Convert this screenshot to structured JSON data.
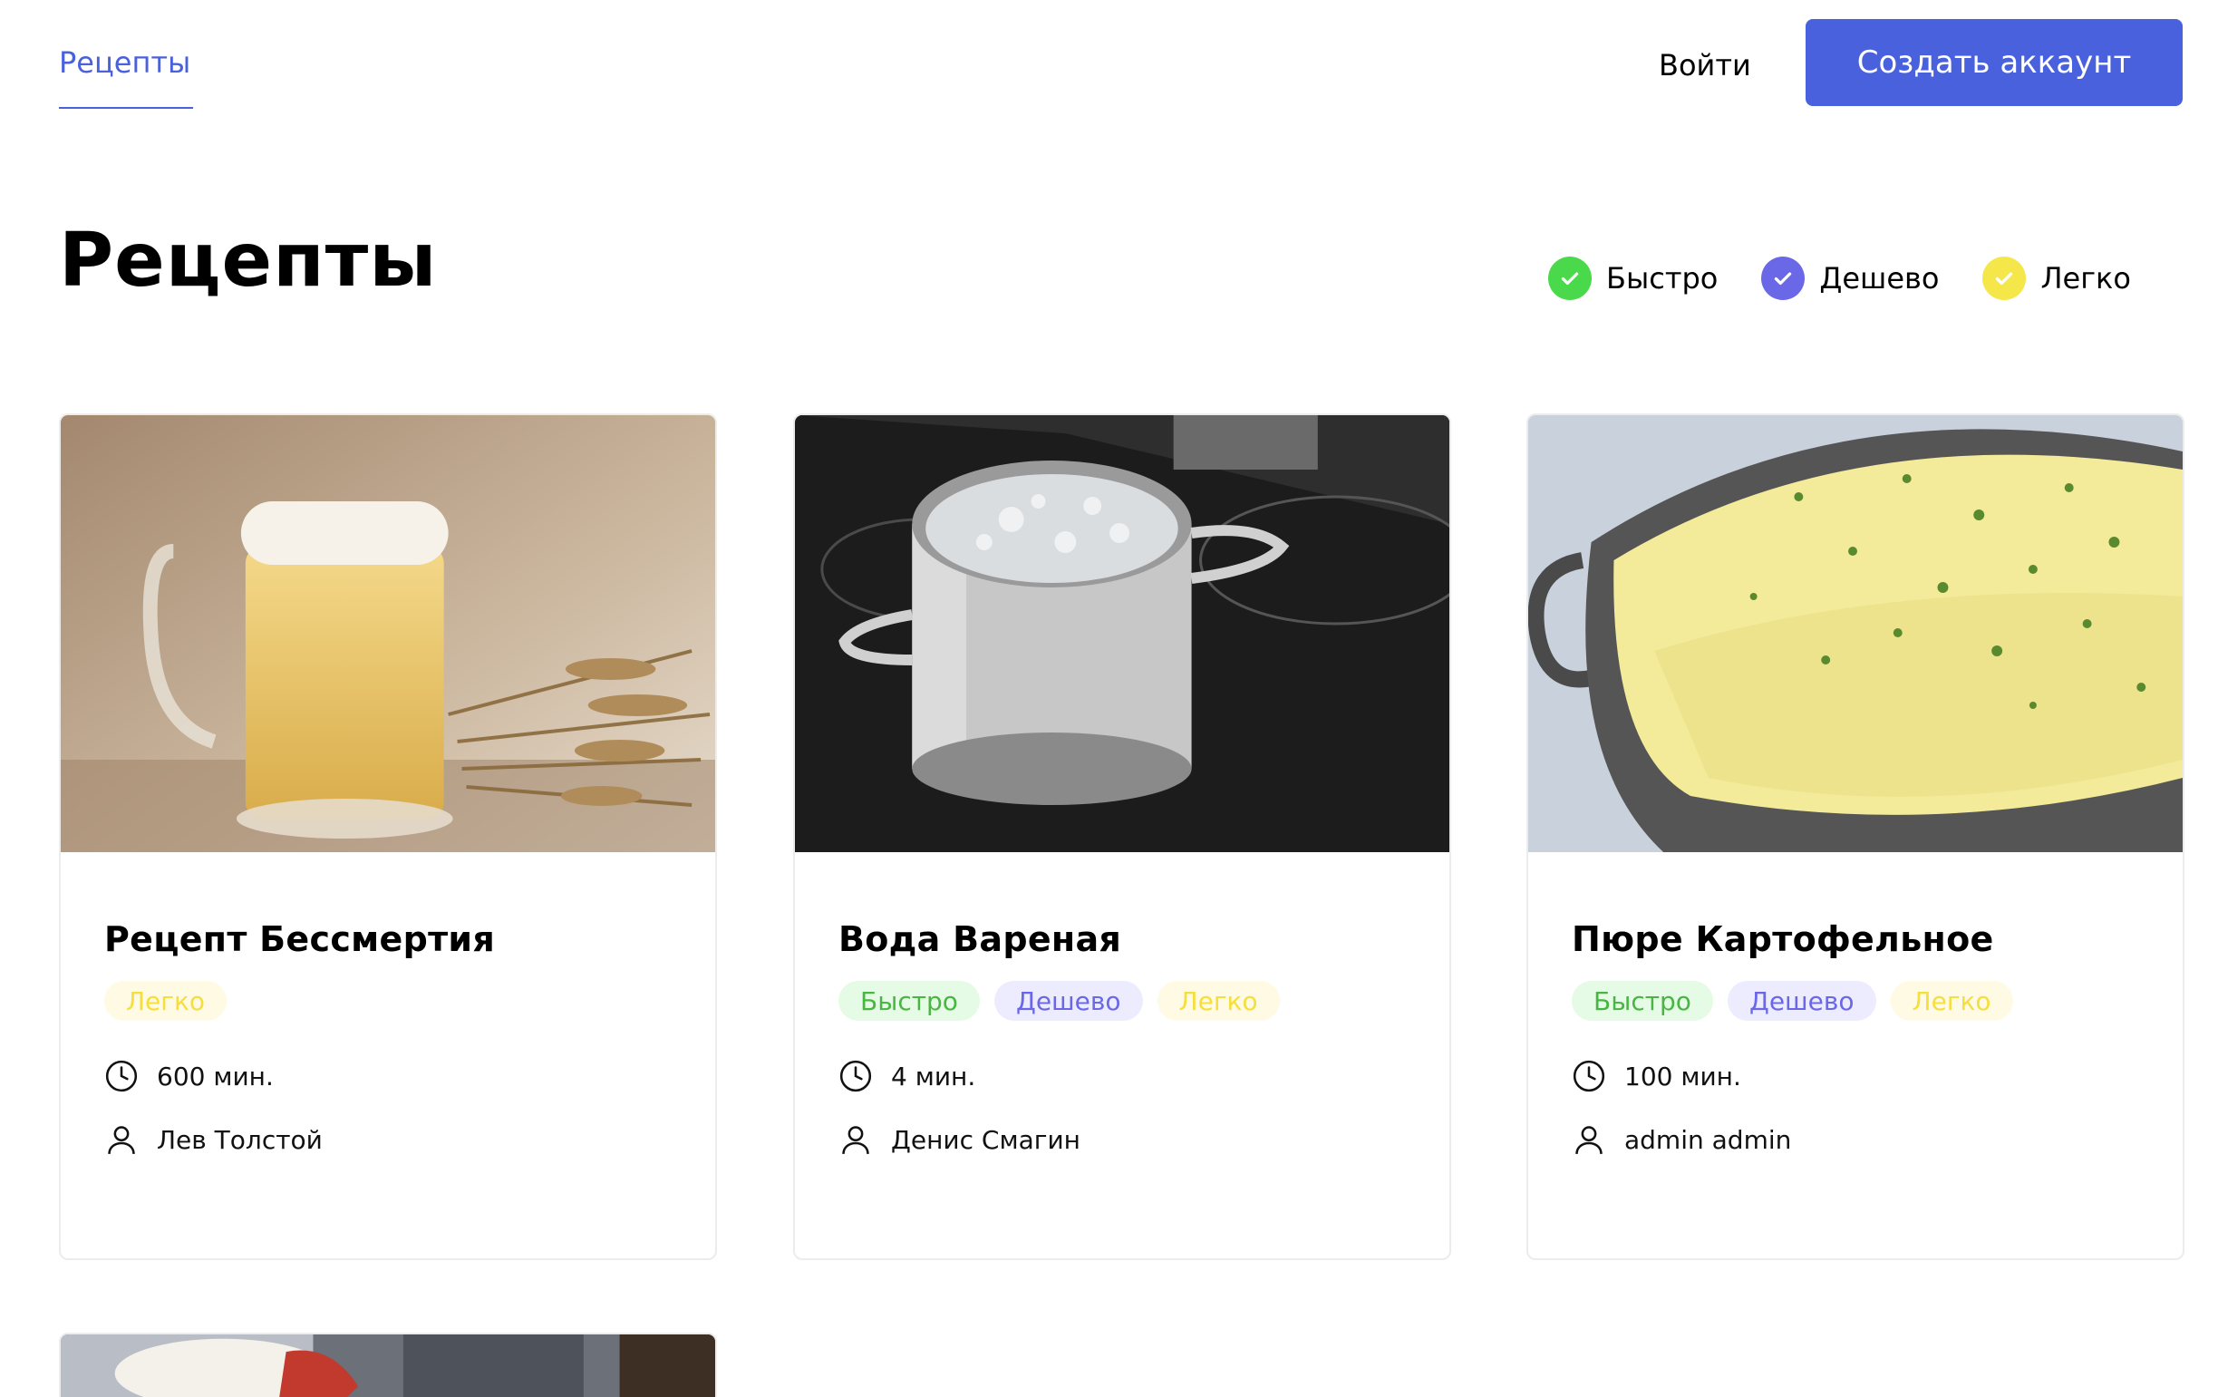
{
  "header": {
    "nav_recipes": "Рецепты",
    "login": "Войти",
    "signup": "Создать аккаунт"
  },
  "page": {
    "title": "Рецепты"
  },
  "filters": [
    {
      "label": "Быстро",
      "color": "#49d94a",
      "checked": true
    },
    {
      "label": "Дешево",
      "color": "#6b68e8",
      "checked": true
    },
    {
      "label": "Легко",
      "color": "#f5e64a",
      "checked": true
    }
  ],
  "recipes": [
    {
      "title": "Рецепт Бессмертия",
      "tags": [
        "Легко"
      ],
      "time": "600 мин.",
      "author": "Лев Толстой",
      "image_icon": "beer-mug-image"
    },
    {
      "title": "Вода Вареная",
      "tags": [
        "Быстро",
        "Дешево",
        "Легко"
      ],
      "time": "4 мин.",
      "author": "Денис Смагин",
      "image_icon": "boiling-pot-image"
    },
    {
      "title": "Пюре Картофельное",
      "tags": [
        "Быстро",
        "Дешево",
        "Легко"
      ],
      "time": "100 мин.",
      "author": "admin admin",
      "image_icon": "mashed-potato-image"
    }
  ],
  "colors": {
    "accent": "#4a61dd",
    "fast": "#49d94a",
    "cheap": "#6b68e8",
    "easy": "#f5e64a"
  }
}
